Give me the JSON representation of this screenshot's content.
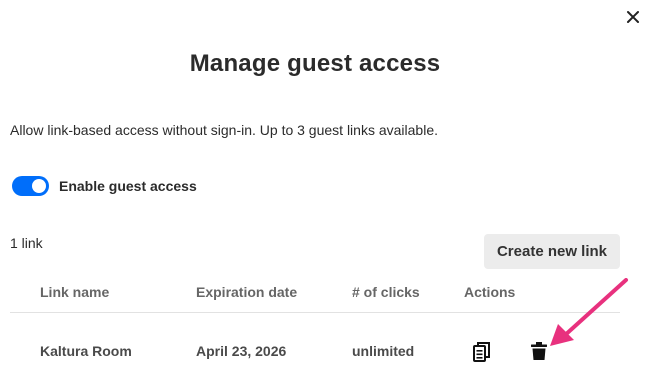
{
  "dialog": {
    "title": "Manage guest access",
    "description": "Allow link-based access without sign-in. Up to 3 guest links available.",
    "close_icon": "close-icon"
  },
  "guest_access": {
    "toggle_label": "Enable guest access",
    "enabled": true
  },
  "links": {
    "count_label": "1 link",
    "create_button": "Create new link",
    "columns": [
      "Link name",
      "Expiration date",
      "# of clicks",
      "Actions"
    ],
    "rows": [
      {
        "name": "Kaltura Room",
        "expiration": "April 23, 2026",
        "clicks": "unlimited",
        "actions": [
          "copy-icon",
          "trash-icon"
        ]
      }
    ]
  },
  "colors": {
    "toggle_accent": "#006EFA",
    "annotation_arrow": "#E8317E"
  }
}
